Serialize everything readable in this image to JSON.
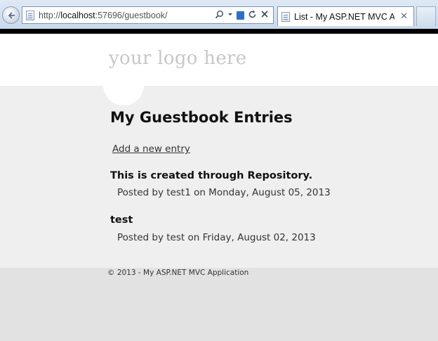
{
  "browser": {
    "url_prefix": "http://",
    "url_host": "localhost",
    "url_rest": ":57696/guestbook/",
    "tab_title": "List - My ASP.NET MVC Ap...",
    "tab_close": "✕",
    "icons": [
      "back-arrow-icon",
      "page-icon",
      "search-icon",
      "compat-view-icon",
      "refresh-icon",
      "stop-icon",
      "close-icon"
    ]
  },
  "page": {
    "logo": "your logo here",
    "title": "My Guestbook Entries",
    "add_link": "Add a new entry",
    "entries": [
      {
        "title": "This is created through Repository.",
        "meta": "Posted by test1 on Monday, August 05, 2013"
      },
      {
        "title": "test",
        "meta": "Posted by test on Friday, August 02, 2013"
      }
    ],
    "footer": "© 2013 - My ASP.NET MVC Application"
  },
  "colors": {
    "header_bg": "#ffffff",
    "content_bg": "#efefef",
    "footer_bg": "#e2e2e2",
    "logo_text": "#c7c7c7"
  }
}
